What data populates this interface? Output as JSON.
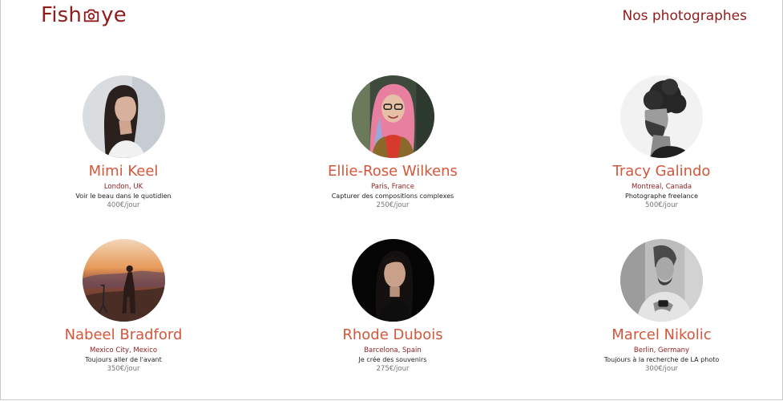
{
  "header": {
    "logo_left": "Fish",
    "logo_right": "ye",
    "logo_icon": "camera-icon",
    "page_title": "Nos photographes"
  },
  "photographers": [
    {
      "name": "Mimi Keel",
      "location": "London, UK",
      "tagline": "Voir le beau dans le quotidien",
      "price": "400€/jour"
    },
    {
      "name": "Ellie-Rose Wilkens",
      "location": "Paris, France",
      "tagline": "Capturer des compositions complexes",
      "price": "250€/jour"
    },
    {
      "name": "Tracy Galindo",
      "location": "Montreal, Canada",
      "tagline": "Photographe freelance",
      "price": "500€/jour"
    },
    {
      "name": "Nabeel Bradford",
      "location": "Mexico City, Mexico",
      "tagline": "Toujours aller de l'avant",
      "price": "350€/jour"
    },
    {
      "name": "Rhode Dubois",
      "location": "Barcelona, Spain",
      "tagline": "Je crée des souvenirs",
      "price": "275€/jour"
    },
    {
      "name": "Marcel Nikolic",
      "location": "Berlin, Germany",
      "tagline": "Toujours à la recherche de LA photo",
      "price": "300€/jour"
    }
  ],
  "colors": {
    "brand": "#901c1c",
    "name": "#d3573c",
    "price": "#757575"
  }
}
